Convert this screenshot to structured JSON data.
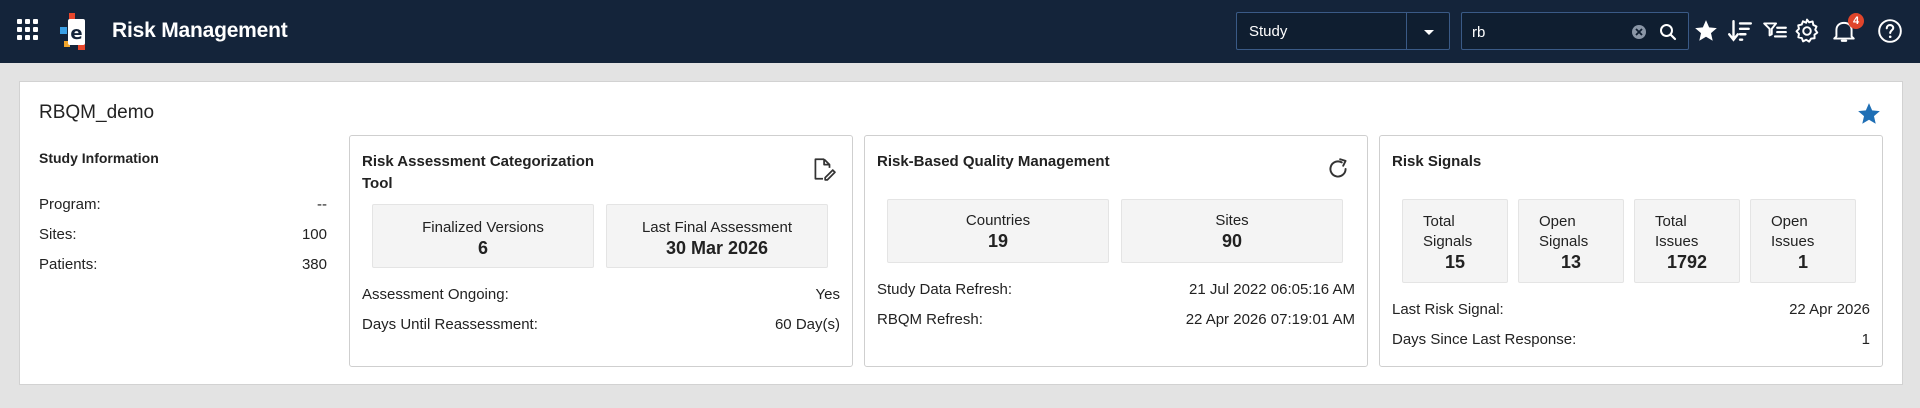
{
  "app": {
    "title": "Risk Management",
    "accent": "#14243a",
    "badge_color": "#e0452b"
  },
  "toolbar": {
    "study_selector_value": "Study",
    "search_value": "rb",
    "notification_count": "4"
  },
  "study": {
    "name": "RBQM_demo"
  },
  "study_info": {
    "heading": "Study Information",
    "rows": [
      {
        "label": "Program:",
        "value": "--"
      },
      {
        "label": "Sites:",
        "value": "100"
      },
      {
        "label": "Patients:",
        "value": "380"
      }
    ]
  },
  "ract": {
    "title_line1": "Risk Assessment Categorization",
    "title_line2": "Tool",
    "stats": [
      {
        "label": "Finalized Versions",
        "value": "6"
      },
      {
        "label": "Last Final Assessment",
        "value": "30 Mar 2026"
      }
    ],
    "rows": [
      {
        "label": "Assessment Ongoing:",
        "value": "Yes"
      },
      {
        "label": "Days Until Reassessment:",
        "value": "60 Day(s)"
      }
    ]
  },
  "rbqm": {
    "title": "Risk-Based Quality Management",
    "stats": [
      {
        "label": "Countries",
        "value": "19"
      },
      {
        "label": "Sites",
        "value": "90"
      }
    ],
    "rows": [
      {
        "label": "Study Data Refresh:",
        "value": "21 Jul 2022 06:05:16 AM"
      },
      {
        "label": "RBQM Refresh:",
        "value": "22 Apr 2026 07:19:01 AM"
      }
    ]
  },
  "signals": {
    "title": "Risk Signals",
    "stats": [
      {
        "label_line1": "Total",
        "label_line2": "Signals",
        "value": "15"
      },
      {
        "label_line1": "Open",
        "label_line2": "Signals",
        "value": "13"
      },
      {
        "label_line1": "Total",
        "label_line2": "Issues",
        "value": "1792"
      },
      {
        "label_line1": "Open",
        "label_line2": "Issues",
        "value": "1"
      }
    ],
    "rows": [
      {
        "label": "Last Risk Signal:",
        "value": "22 Apr 2026"
      },
      {
        "label": "Days Since Last Response:",
        "value": "1"
      }
    ]
  }
}
